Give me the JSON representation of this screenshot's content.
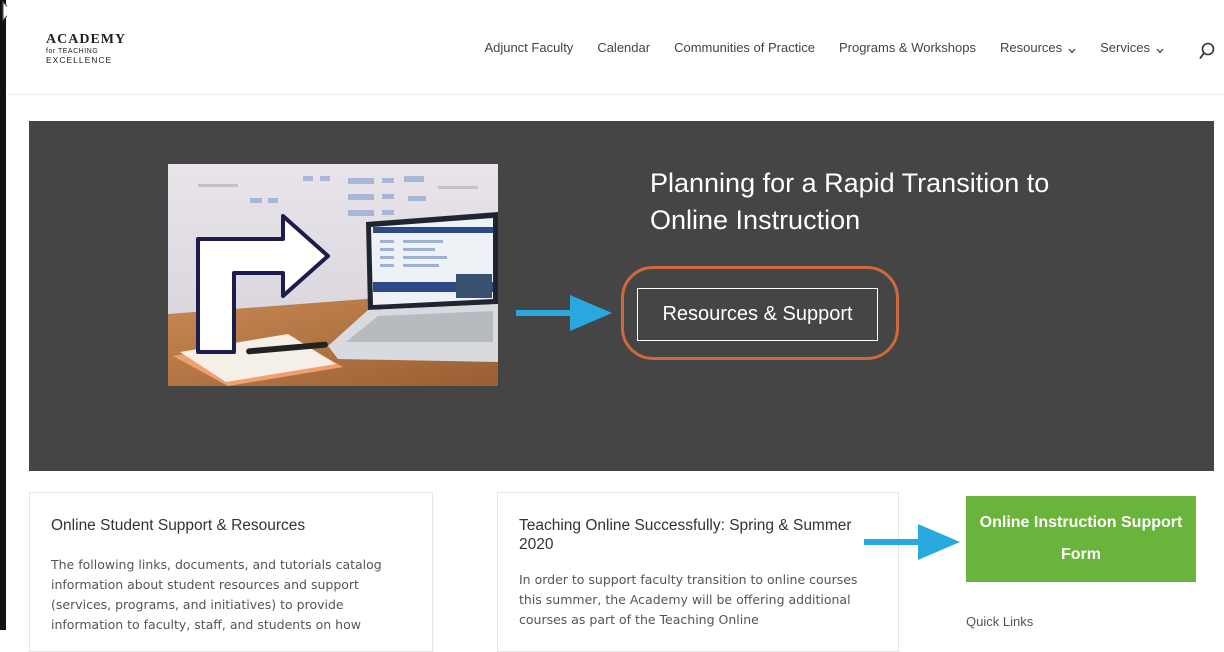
{
  "logo": {
    "line1": "ACADEMY",
    "line2": "for TEACHING",
    "line3": "EXCELLENCE"
  },
  "nav": {
    "items": [
      {
        "label": "Adjunct Faculty",
        "dropdown": false
      },
      {
        "label": "Calendar",
        "dropdown": false
      },
      {
        "label": "Communities of Practice",
        "dropdown": false
      },
      {
        "label": "Programs & Workshops",
        "dropdown": false
      },
      {
        "label": "Resources",
        "dropdown": true
      },
      {
        "label": "Services",
        "dropdown": true
      }
    ],
    "search_icon": "search-icon"
  },
  "hero": {
    "title": "Planning for a Rapid Transition to Online Instruction",
    "button_label": "Resources & Support"
  },
  "cards": [
    {
      "title": "Online Student Support & Resources",
      "body": "The following links, documents, and tutorials catalog information about student resources and support (services, programs, and initiatives) to provide information to faculty, staff, and students on how"
    },
    {
      "title": "Teaching Online Successfully: Spring & Summer 2020",
      "body": "In order to support faculty transition to online courses this summer, the Academy will be offering additional courses as part of the Teaching Online"
    }
  ],
  "sidebar": {
    "form_button": "Online Instruction Support Form",
    "quick_links": "Quick Links"
  },
  "colors": {
    "hero_bg": "#454545",
    "highlight_oval": "#d0683f",
    "arrow": "#29a8e0",
    "green_button": "#6ab43b"
  }
}
